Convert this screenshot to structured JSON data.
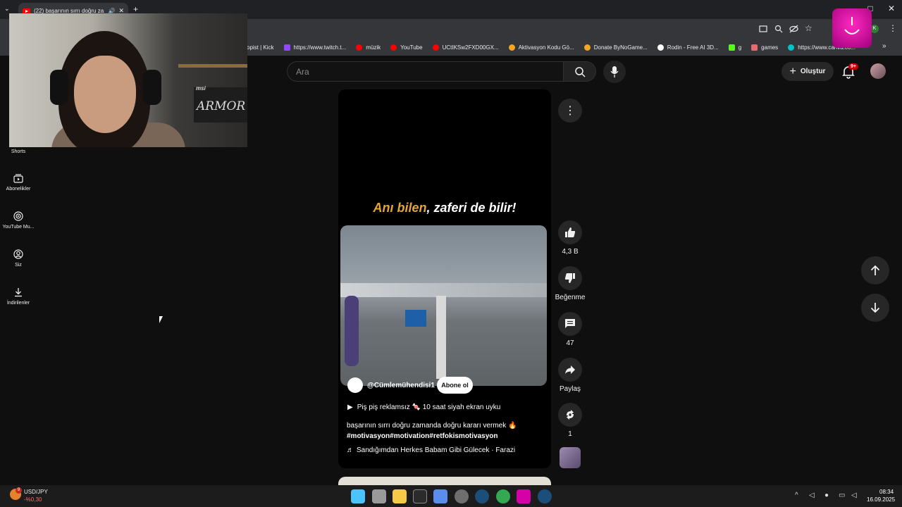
{
  "browser": {
    "tab_title": "(22) başarının sırrı doğru za...",
    "new_tab": "+",
    "window_controls": [
      "—",
      "□",
      "✕"
    ],
    "bookmarks": [
      {
        "label": "opist | Kick",
        "color": "#53fc18"
      },
      {
        "label": "https://www.twitch.t...",
        "color": "#9146ff"
      },
      {
        "label": "müzik",
        "color": "#ff0000"
      },
      {
        "label": "YouTube",
        "color": "#ff0000"
      },
      {
        "label": "UCtIKSw2FXD00GX...",
        "color": "#ff0000"
      },
      {
        "label": "Aktivasyon Kodu Gö...",
        "color": "#f5a623"
      },
      {
        "label": "Donate ByNoGame...",
        "color": "#f5a623"
      },
      {
        "label": "Rodin - Free AI 3D...",
        "color": "#ffffff"
      },
      {
        "label": "g",
        "color": "#53fc18"
      },
      {
        "label": "games",
        "color": "#e86a6a"
      },
      {
        "label": "https://www.canva.co...",
        "color": "#00c4cc"
      }
    ],
    "bookmarks_overflow": "»"
  },
  "header": {
    "search_placeholder": "Ara",
    "create_label": "Oluştur",
    "notification_count": "9+"
  },
  "sidebar": {
    "items": [
      {
        "label": "Shorts",
        "icon": "shorts-icon"
      },
      {
        "label": "Abonelikler",
        "icon": "subscriptions-icon"
      },
      {
        "label": "YouTube Mu...",
        "icon": "youtube-music-icon"
      },
      {
        "label": "Siz",
        "icon": "you-icon"
      },
      {
        "label": "İndirilenler",
        "icon": "download-icon"
      }
    ]
  },
  "webcam": {
    "monitor_brand": "msi",
    "monitor_model": "ARMOR"
  },
  "short": {
    "headline_highlight": "Anı bilen",
    "headline_rest": ", zaferi de bilir!",
    "channel_name": "@Cümlemühendisi1",
    "subscribe_label": "Abone ol",
    "playlist": "Piş piş reklamsız 🍬 10 saat siyah ekran  uyku",
    "description": "başarının sırrı doğru zamanda doğru kararı vermek 🔥",
    "hashtags": "#motivasyon#motivation#retfokismotivasyon",
    "music": "Sandığımdan Herkes Babam Gibi Gülecek · Farazi",
    "likes": "4,3 B",
    "dislike_label": "Beğenme",
    "comments": "47",
    "share_label": "Paylaş",
    "remix_count": "1"
  },
  "taskbar": {
    "ticker_name": "USD/JPY",
    "ticker_change": "-%0,30",
    "ticker_badge": "9",
    "time": "08:34",
    "date": "16.09.2025",
    "apps": [
      {
        "name": "windows-start",
        "color": "#4cc2ff"
      },
      {
        "name": "task-view",
        "color": "#9a9a9a"
      },
      {
        "name": "file-explorer",
        "color": "#f7c948"
      },
      {
        "name": "epic-games",
        "color": "#2b2b2b"
      },
      {
        "name": "copilot",
        "color": "#5b8def"
      },
      {
        "name": "github-desktop",
        "color": "#6e6e6e"
      },
      {
        "name": "steam",
        "color": "#1b4f79"
      },
      {
        "name": "chrome",
        "color": "#34a853"
      },
      {
        "name": "streamer-app",
        "color": "#d500a8"
      },
      {
        "name": "steam-2",
        "color": "#1b4f79"
      }
    ]
  }
}
